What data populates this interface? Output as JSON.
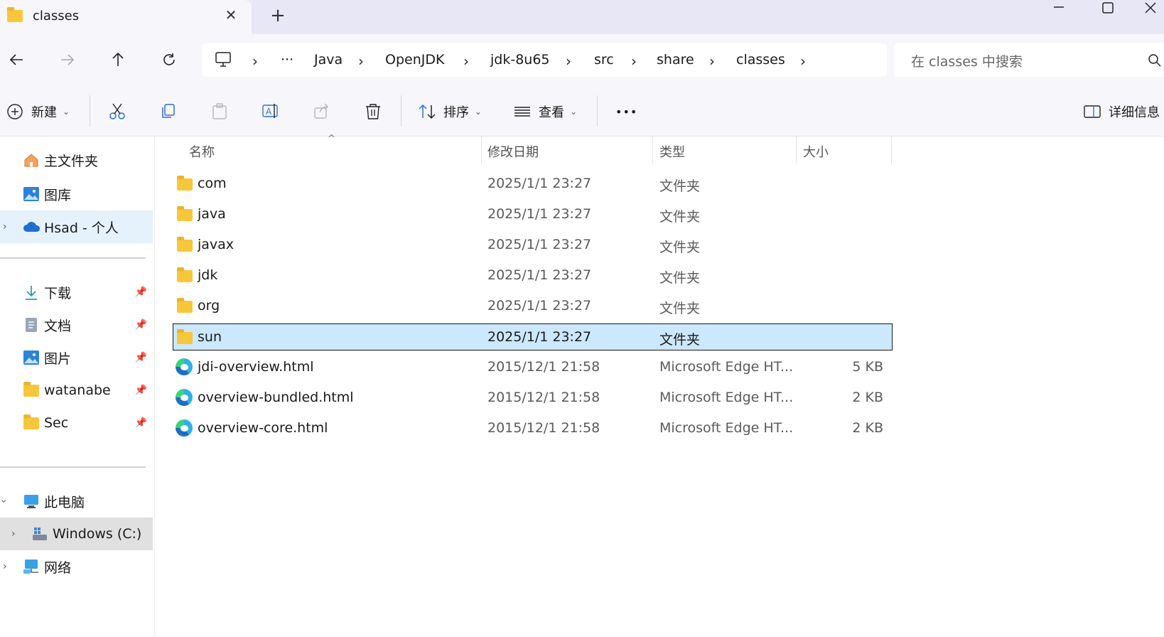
{
  "window": {
    "tab_title": "classes",
    "tab_close": "✕",
    "new_tab": "+"
  },
  "breadcrumb": {
    "ellipsis": "···",
    "items": [
      "Java",
      "OpenJDK",
      "jdk-8u65",
      "src",
      "share",
      "classes"
    ]
  },
  "search": {
    "placeholder": "在 classes 中搜索"
  },
  "toolbar": {
    "new_label": "新建",
    "sort_label": "排序",
    "view_label": "查看",
    "more_label": "•••",
    "details_label": "详细信息"
  },
  "sidebar": {
    "home": "主文件夹",
    "gallery": "图库",
    "onedrive": "Hsad - 个人",
    "pinned": [
      "下载",
      "文档",
      "图片",
      "watanabe",
      "Sec"
    ],
    "this_pc": "此电脑",
    "drive_c": "Windows (C:)",
    "network": "网络"
  },
  "columns": {
    "name": "名称",
    "date": "修改日期",
    "type": "类型",
    "size": "大小"
  },
  "files": [
    {
      "name": "com",
      "date": "2025/1/1 23:27",
      "type": "文件夹",
      "size": "",
      "icon": "folder-icon"
    },
    {
      "name": "java",
      "date": "2025/1/1 23:27",
      "type": "文件夹",
      "size": "",
      "icon": "folder-icon"
    },
    {
      "name": "javax",
      "date": "2025/1/1 23:27",
      "type": "文件夹",
      "size": "",
      "icon": "folder-icon"
    },
    {
      "name": "jdk",
      "date": "2025/1/1 23:27",
      "type": "文件夹",
      "size": "",
      "icon": "folder-icon"
    },
    {
      "name": "org",
      "date": "2025/1/1 23:27",
      "type": "文件夹",
      "size": "",
      "icon": "folder-icon"
    },
    {
      "name": "sun",
      "date": "2025/1/1 23:27",
      "type": "文件夹",
      "size": "",
      "icon": "folder-icon"
    },
    {
      "name": "jdi-overview.html",
      "date": "2015/12/1 21:58",
      "type": "Microsoft Edge HT...",
      "size": "5 KB",
      "icon": "edge-icon"
    },
    {
      "name": "overview-bundled.html",
      "date": "2015/12/1 21:58",
      "type": "Microsoft Edge HT...",
      "size": "2 KB",
      "icon": "edge-icon"
    },
    {
      "name": "overview-core.html",
      "date": "2015/12/1 21:58",
      "type": "Microsoft Edge HT...",
      "size": "2 KB",
      "icon": "edge-icon"
    }
  ],
  "colors": {
    "selected_row": "#cce8ff",
    "sidebar_active": "#e5f1fb",
    "drive_active": "#e0e0e0",
    "folder_yellow": "#f8c63a"
  }
}
